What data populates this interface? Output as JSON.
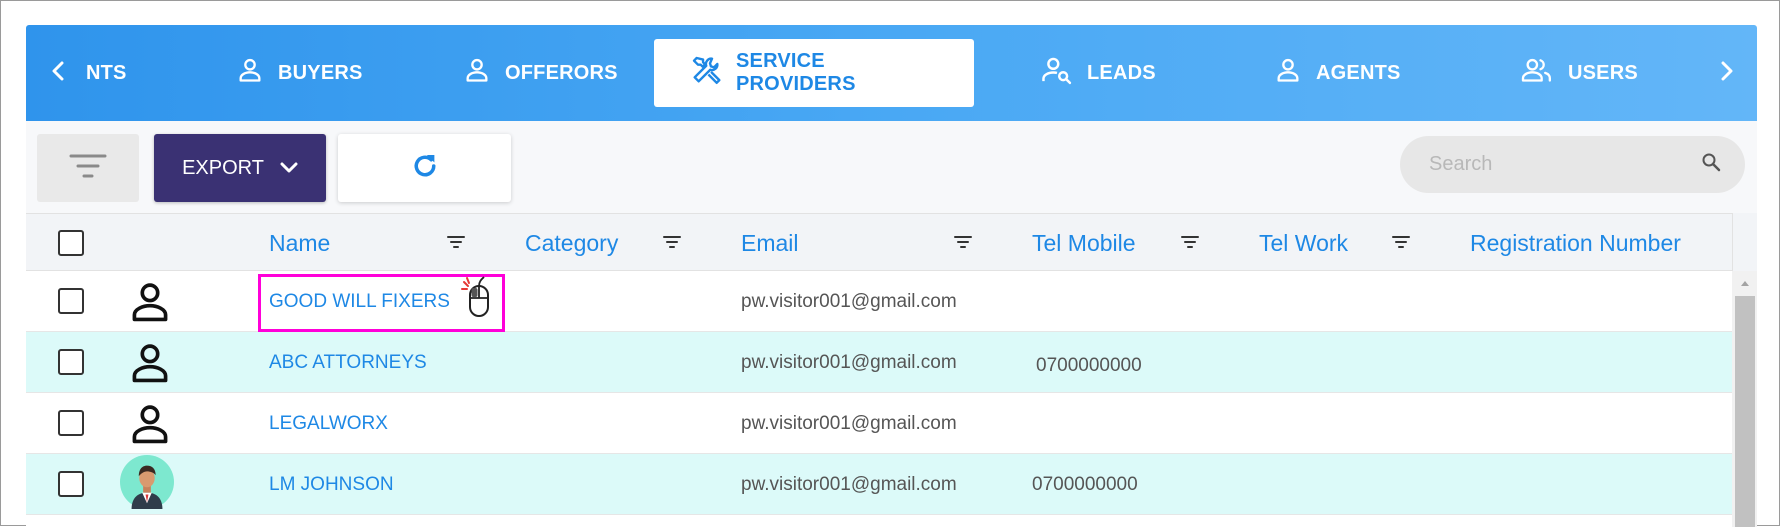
{
  "tabs": {
    "items": [
      {
        "label": "NTS",
        "icon": "chevron-left-icon"
      },
      {
        "label": "BUYERS",
        "icon": "person-icon"
      },
      {
        "label": "OFFERORS",
        "icon": "person-icon"
      },
      {
        "label": "SERVICE PROVIDERS",
        "icon": "tools-icon",
        "active": true
      },
      {
        "label": "LEADS",
        "icon": "person-search-icon"
      },
      {
        "label": "AGENTS",
        "icon": "person-icon"
      },
      {
        "label": "USERS",
        "icon": "people-icon"
      }
    ],
    "right_arrow_icon": "chevron-right-icon"
  },
  "toolbar": {
    "filter_icon": "filter-lines-icon",
    "export_label": "EXPORT",
    "refresh_icon": "refresh-icon",
    "search_placeholder": "Search",
    "search_icon": "search-icon"
  },
  "table": {
    "columns": [
      "Name",
      "Category",
      "Email",
      "Tel Mobile",
      "Tel Work",
      "Registration Number"
    ],
    "rows": [
      {
        "avatar": "person-outline-icon",
        "name": "GOOD WILL FIXERS",
        "category": "",
        "email": "pw.visitor001@gmail.com",
        "tel_mobile": "",
        "tel_work": "",
        "reg": ""
      },
      {
        "avatar": "person-outline-icon",
        "name": "ABC ATTORNEYS",
        "category": "",
        "email": "pw.visitor001@gmail.com",
        "tel_mobile": "0700000000",
        "tel_work": "",
        "reg": ""
      },
      {
        "avatar": "person-outline-icon",
        "name": "LEGALWORX",
        "category": "",
        "email": "pw.visitor001@gmail.com",
        "tel_mobile": "",
        "tel_work": "",
        "reg": ""
      },
      {
        "avatar": "profile-photo-avatar",
        "name": "LM JOHNSON",
        "category": "",
        "email": "pw.visitor001@gmail.com",
        "tel_mobile": "0700000000",
        "tel_work": "",
        "reg": ""
      }
    ]
  },
  "colors": {
    "tabbar_start": "#2f94ec",
    "tabbar_end": "#63b6f8",
    "accent": "#1e88e5",
    "export_bg": "#3a3173",
    "alt_row": "#dcfaf9",
    "highlight": "#ff00d9"
  }
}
